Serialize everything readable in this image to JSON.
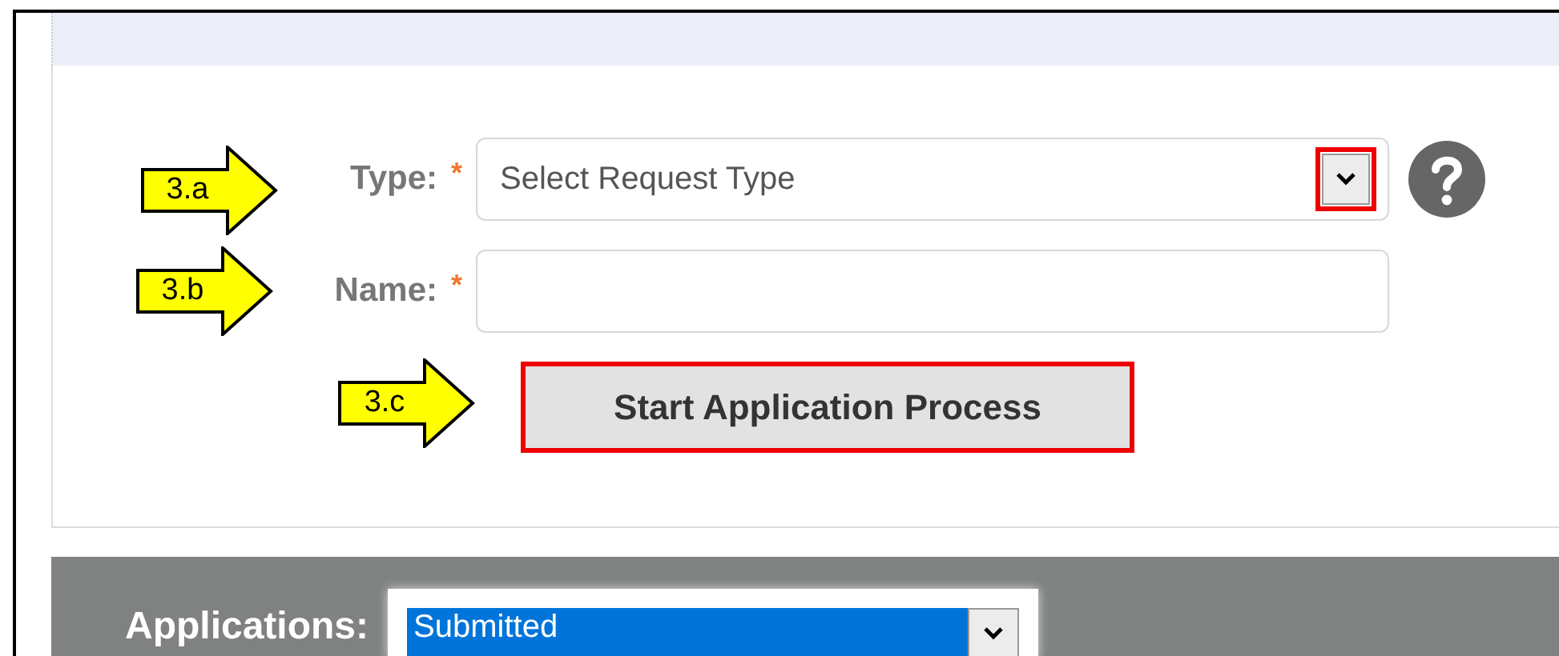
{
  "callouts": [
    {
      "label": "3.a"
    },
    {
      "label": "3.b"
    },
    {
      "label": "3.c"
    }
  ],
  "form": {
    "type": {
      "label": "Type:",
      "required_mark": "*",
      "placeholder": "Select Request Type",
      "dropdown_highlighted": true
    },
    "name": {
      "label": "Name:",
      "required_mark": "*"
    },
    "start_button": {
      "label": "Start Application Process",
      "highlighted": true
    }
  },
  "applications": {
    "label": "Applications:",
    "value": "Submitted"
  }
}
